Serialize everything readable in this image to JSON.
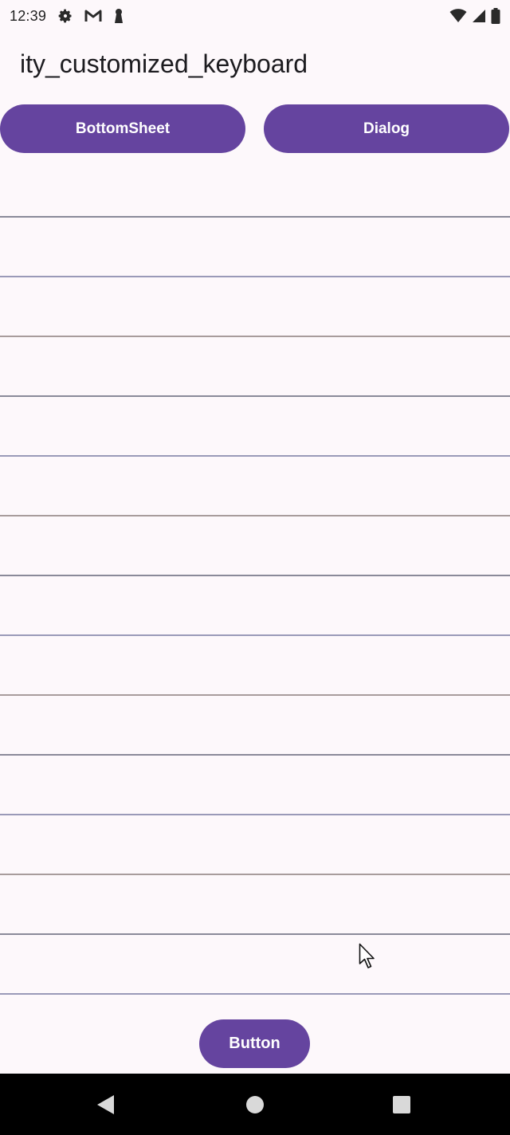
{
  "status_bar": {
    "time": "12:39",
    "icons": [
      "gear-icon",
      "gmail-icon",
      "keyhole-icon",
      "wifi-icon",
      "signal-icon",
      "battery-icon"
    ]
  },
  "app": {
    "title": "ity_customized_keyboard"
  },
  "buttons": {
    "bottom_sheet": "BottomSheet",
    "dialog": "Dialog",
    "bottom": "Button"
  },
  "fields": [
    {
      "value": ""
    },
    {
      "value": ""
    },
    {
      "value": ""
    },
    {
      "value": ""
    },
    {
      "value": ""
    },
    {
      "value": ""
    },
    {
      "value": ""
    },
    {
      "value": ""
    },
    {
      "value": ""
    },
    {
      "value": ""
    },
    {
      "value": ""
    },
    {
      "value": ""
    },
    {
      "value": ""
    },
    {
      "value": ""
    }
  ],
  "nav_bar": {
    "icons": [
      "back-icon",
      "home-icon",
      "recents-icon"
    ]
  },
  "colors": {
    "primary": "#65449f",
    "background": "#fdf8fb",
    "on_primary": "#ffffff"
  }
}
